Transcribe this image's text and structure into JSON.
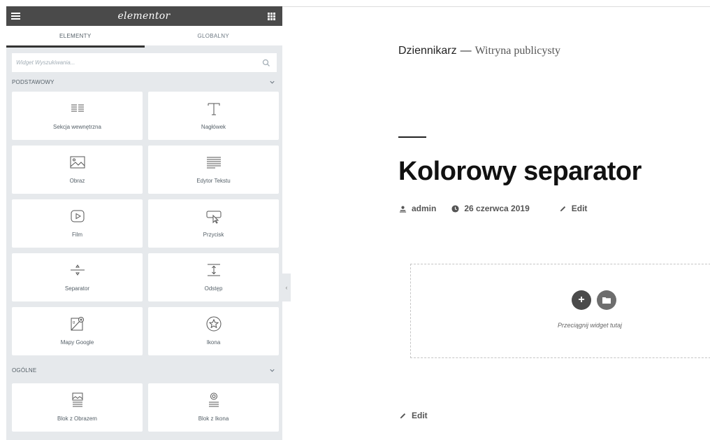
{
  "panel": {
    "brand": "elementor",
    "tabs": [
      {
        "label": "ELEMENTY",
        "active": true
      },
      {
        "label": "GLOBALNY",
        "active": false
      }
    ],
    "search": {
      "placeholder": "Widget Wyszukiwania..."
    },
    "categories": [
      {
        "title": "PODSTAWOWY",
        "widgets": [
          {
            "label": "Sekcja wewnętrzna",
            "icon": "inner-section-icon"
          },
          {
            "label": "Nagłówek",
            "icon": "heading-icon"
          },
          {
            "label": "Obraz",
            "icon": "image-icon"
          },
          {
            "label": "Edytor Tekstu",
            "icon": "text-editor-icon"
          },
          {
            "label": "Film",
            "icon": "video-icon"
          },
          {
            "label": "Przycisk",
            "icon": "button-icon"
          },
          {
            "label": "Separator",
            "icon": "divider-icon"
          },
          {
            "label": "Odstęp",
            "icon": "spacer-icon"
          },
          {
            "label": "Mapy Google",
            "icon": "google-maps-icon"
          },
          {
            "label": "Ikona",
            "icon": "star-icon"
          }
        ]
      },
      {
        "title": "OGÓLNE",
        "widgets": [
          {
            "label": "Blok z Obrazem",
            "icon": "image-box-icon"
          },
          {
            "label": "Blok z Ikona",
            "icon": "icon-box-icon"
          }
        ]
      }
    ]
  },
  "preview": {
    "site_name": "Dziennikarz",
    "site_separator": "—",
    "site_tagline": "Witryna publicysty",
    "post_title": "Kolorowy separator",
    "meta": {
      "author": "admin",
      "date": "26 czerwca 2019",
      "edit": "Edit"
    },
    "dropzone": {
      "add_symbol": "+",
      "label": "Przeciągnij widget tutaj"
    },
    "bottom_edit": "Edit"
  },
  "colors": {
    "panel_bg": "#e6e9ec",
    "header_bg": "#4a4a4a",
    "add_button": "#4a4a4a",
    "template_button": "#6d6d6d"
  }
}
